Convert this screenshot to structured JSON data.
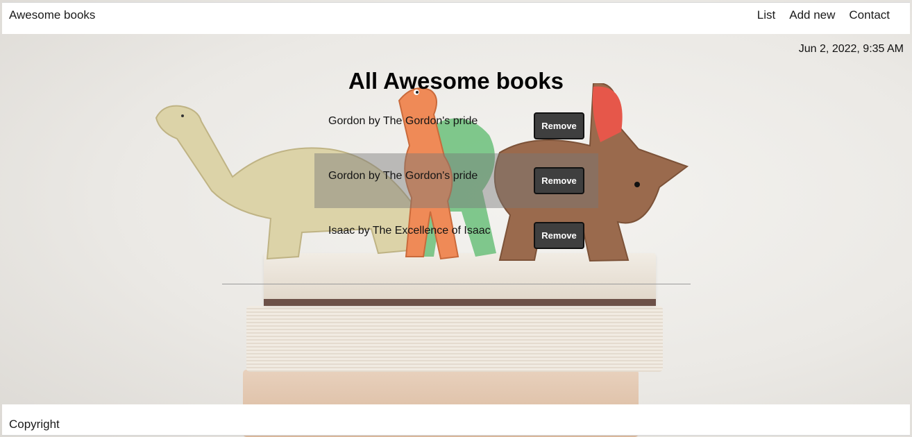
{
  "header": {
    "brand": "Awesome books",
    "nav": [
      {
        "label": "List"
      },
      {
        "label": "Add new"
      },
      {
        "label": "Contact"
      }
    ]
  },
  "datetime": "Jun 2, 2022, 9:35 AM",
  "main": {
    "title": "All Awesome books",
    "books": [
      {
        "text": "Gordon by The Gordon's pride",
        "remove_label": "Remove"
      },
      {
        "text": "Gordon by The Gordon's pride",
        "remove_label": "Remove"
      },
      {
        "text": "Isaac by The Excellence of Isaac",
        "remove_label": "Remove"
      }
    ]
  },
  "footer": {
    "copyright": "Copyright"
  },
  "colors": {
    "remove_button_bg": "#3f3f3f",
    "row_stripe": "#787878"
  }
}
